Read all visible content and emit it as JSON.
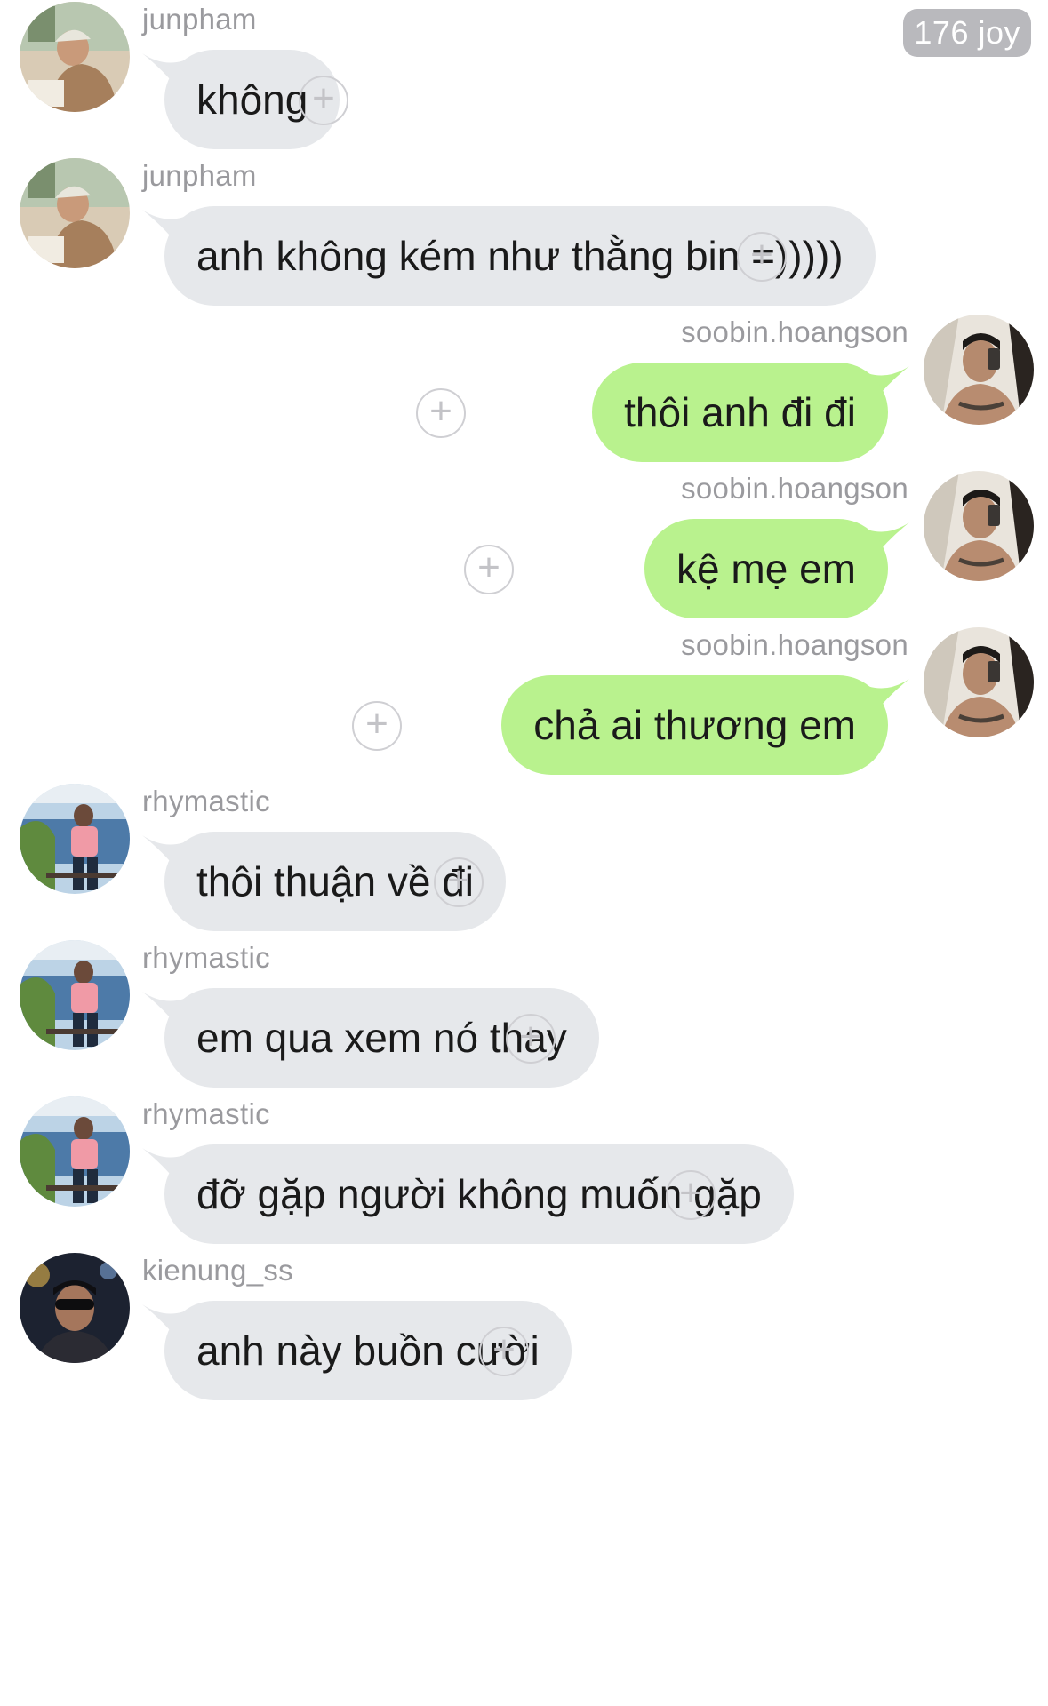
{
  "header": {
    "badge_text": "176 joy"
  },
  "colors": {
    "incoming_bubble": "#e6e8eb",
    "outgoing_bubble": "#b9f28e",
    "username_text": "#9a9a9e",
    "add_button": "#cfcfd3",
    "badge_bg": "#b9b9bd"
  },
  "messages": [
    {
      "side": "left",
      "username": "junpham",
      "text": "không",
      "avatar": "junpham-avatar"
    },
    {
      "side": "left",
      "username": "junpham",
      "text": "anh không kém như thằng bin =)))))",
      "avatar": "junpham-avatar"
    },
    {
      "side": "right",
      "username": "soobin.hoangson",
      "text": "thôi anh đi đi",
      "avatar": "soobin-avatar"
    },
    {
      "side": "right",
      "username": "soobin.hoangson",
      "text": "kệ mẹ em",
      "avatar": "soobin-avatar"
    },
    {
      "side": "right",
      "username": "soobin.hoangson",
      "text": "chả ai thương em",
      "avatar": "soobin-avatar"
    },
    {
      "side": "left",
      "username": "rhymastic",
      "text": "thôi thuận về đi",
      "avatar": "rhymastic-avatar"
    },
    {
      "side": "left",
      "username": "rhymastic",
      "text": "em qua xem nó thay",
      "avatar": "rhymastic-avatar"
    },
    {
      "side": "left",
      "username": "rhymastic",
      "text": "đỡ gặp người không muốn gặp",
      "avatar": "rhymastic-avatar"
    },
    {
      "side": "left",
      "username": "kienung_ss",
      "text": "anh này buồn cười",
      "avatar": "kienung-avatar"
    }
  ],
  "add_button_symbol": "+"
}
